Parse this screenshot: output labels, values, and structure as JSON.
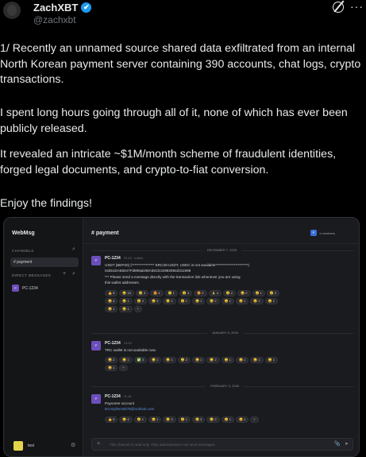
{
  "post": {
    "author_name": "ZachXBT",
    "verified_mark": "✔",
    "handle": "@zachxbt",
    "more_glyph": "···",
    "paragraphs": [
      "1/ Recently an unnamed source shared data exfiltrated from an internal North Korean payment server containing 390 accounts, chat logs, crypto transactions.",
      "I spent long hours going through all of it, none of which has ever been publicly released.",
      "It revealed an intricate ~$1M/month scheme of fraudulent identities, forged legal documents, and crypto-to-fiat conversion.",
      "Enjoy the findings!"
    ]
  },
  "app": {
    "brand": "WebMsg",
    "channels_label": "CHANNELS",
    "channel_active": "# payment",
    "dm_label": "DIRECT MESSAGES",
    "dm_user": "PC-1234",
    "dm_initial": "P",
    "me_name": "test",
    "header_channel": "# payment",
    "members_initial": "P",
    "members_text": "1 members",
    "divider1": "DECEMBER 7, 2025",
    "divider2": "JANUARY 5, 2026",
    "divider3": "FEBRUARY 3, 2026",
    "msg1": {
      "initial": "P",
      "user": "PC-1234",
      "time": "22:43 · edited",
      "text": "USDT (BEP20) (**************** ERC20-USDT, USDC is not available***********************)\n0xb51DA55047Fd899aD08Ab5CE34982984d311998\n*** Please send a message directly with the transaction link whenever you are using\nthis wallet addresses."
    },
    "msg1_reactions": [
      "👍 9",
      "😀 10",
      "😂 3",
      "😍 4",
      "😢 1",
      "😮 4",
      "😡 2",
      "🙏 4",
      "😀 2",
      "😀 2",
      "😀 1",
      "😀 2",
      "😀 4",
      "😀 1",
      "😀 2",
      "😀 3",
      "😀 1",
      "😀 1",
      "😀 1",
      "😀 2",
      "😀 1",
      "😀 1",
      "😀 1",
      "😀 1",
      "😀 1",
      "😀 1",
      "+"
    ],
    "msg2": {
      "initial": "P",
      "user": "PC-1234",
      "time": "14:33",
      "text": "TRC wallet is not available now."
    },
    "msg2_reactions": [
      "😀 2",
      "😀 1",
      "✅ 3",
      "😀 1",
      "😀 1",
      "😀 2",
      "😀 1",
      "😀 2",
      "😀 1",
      "😀 1",
      "😀 1",
      "😀 1",
      "😀 1",
      "+"
    ],
    "msg3": {
      "initial": "P",
      "user": "PC-1234",
      "time": "11:18",
      "text": "Payoneer account",
      "link": "Bccstyllemstk78@outlook.com"
    },
    "msg3_reactions": [
      "👍 9",
      "😀 4",
      "😀 1",
      "😀 1",
      "😀 3",
      "😀 1",
      "😀 3",
      "😀 2",
      "😀 1",
      "😀 1",
      "+"
    ],
    "composer_placeholder": "This channel is read-only. Only administrators can send messages.",
    "icons": {
      "search": "⌕",
      "plus": "+",
      "gear": "⚙",
      "paperclip": "📎",
      "send": "➤"
    },
    "colors": {
      "avatar_purple": "#6b4fbb",
      "link_blue": "#5b8de0",
      "me_yellow": "#e3d44a"
    }
  }
}
